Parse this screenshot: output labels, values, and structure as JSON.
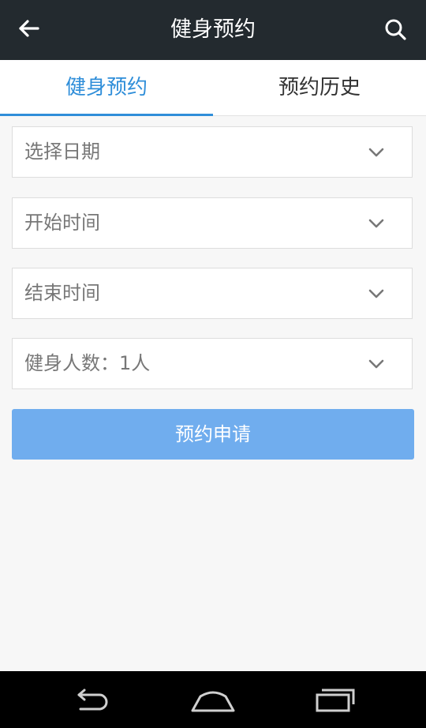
{
  "appbar": {
    "title": "健身预约"
  },
  "tabs": [
    {
      "label": "健身预约",
      "selected": true
    },
    {
      "label": "预约历史",
      "selected": false
    }
  ],
  "form": {
    "date_label": "选择日期",
    "start_time_label": "开始时间",
    "end_time_label": "结束时间",
    "people_label": "健身人数：1人",
    "submit_label": "预约申请"
  },
  "colors": {
    "appbar_bg": "#232a2f",
    "accent": "#2f8ed9",
    "button_bg": "#70adee"
  }
}
